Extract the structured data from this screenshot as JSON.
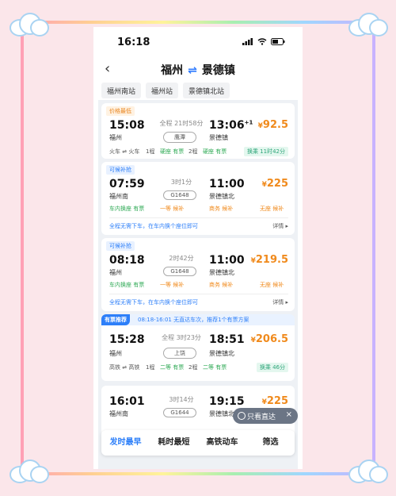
{
  "status": {
    "time": "16:18"
  },
  "nav": {
    "from": "福州",
    "swap": "⇌",
    "to": "景德镇",
    "back": "‹"
  },
  "stations": [
    "福州南站",
    "福州站",
    "景德镇北站"
  ],
  "trains": [
    {
      "tag": "价格最低",
      "dep_time": "15:08",
      "arr_time": "13:06",
      "day_offset": "+1",
      "duration": "全程 21时58分",
      "train_no": "鹰潭",
      "from_station": "福州",
      "to_station": "景德镇",
      "price": "92.5",
      "seats": [
        "火车 ⇌ 火车",
        "1程",
        "硬座 有票",
        "2程",
        "硬座 有票"
      ],
      "transfer": "换乘 11时42分"
    },
    {
      "tag": "可候补抢",
      "dep_time": "07:59",
      "arr_time": "11:00",
      "duration": "3时1分",
      "train_no": "G1648",
      "from_station": "福州南",
      "to_station": "景德镇北",
      "price": "225",
      "seats": [
        "车内换座 有票",
        "一等 候补",
        "商务 候补",
        "无座 候补"
      ],
      "note": "全程无需下车，在车内换个座位即可",
      "detail": "详情 ▸"
    },
    {
      "tag": "可候补抢",
      "dep_time": "08:18",
      "arr_time": "11:00",
      "duration": "2时42分",
      "train_no": "G1648",
      "from_station": "福州",
      "to_station": "景德镇北",
      "price": "219.5",
      "seats": [
        "车内换座 有票",
        "一等 候补",
        "商务 候补",
        "无座 候补"
      ],
      "note": "全程无需下车，在车内换个座位即可",
      "detail": "详情 ▸"
    },
    {
      "dep_time": "15:28",
      "arr_time": "18:51",
      "duration": "全程 3时23分",
      "train_no": "上饶",
      "from_station": "福州",
      "to_station": "景德镇北",
      "price": "206.5",
      "seats": [
        "高铁 ⇌ 高铁",
        "1程",
        "二等 有票",
        "2程",
        "二等 有票"
      ],
      "transfer": "换乘 46分"
    },
    {
      "dep_time": "16:01",
      "arr_time": "19:15",
      "duration": "3时14分",
      "train_no": "G1644",
      "from_station": "福州南",
      "to_station": "景德镇北",
      "price": "225"
    }
  ],
  "recommend": {
    "badge": "有票推荐",
    "text": "08:18-16:01 无直达车次，推荐1个有票方案"
  },
  "currency": "¥",
  "direct_filter": {
    "label": "只看直达",
    "close": "×"
  },
  "bottom_tabs": [
    "发时最早",
    "耗时最短",
    "高铁动车",
    "筛选"
  ],
  "colors": {
    "accent": "#2d7ff9",
    "price": "#f08a1c",
    "available": "#2faa55"
  }
}
